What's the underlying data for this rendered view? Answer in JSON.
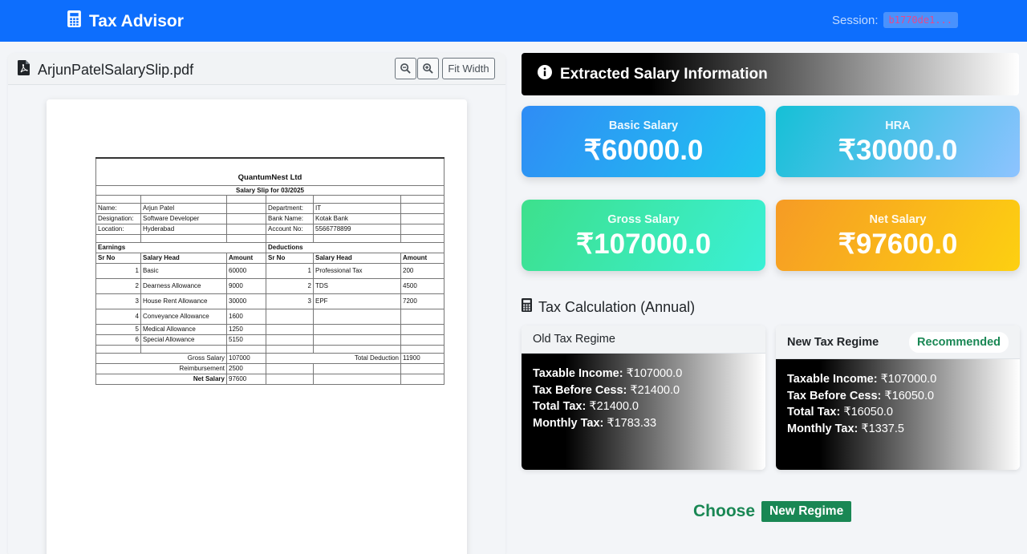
{
  "app": {
    "title": "Tax Advisor",
    "session_label": "Session:",
    "session_id": "b1770de1..."
  },
  "pdf": {
    "filename": "ArjunPatelSalarySlip.pdf",
    "fit_width_label": "Fit Width",
    "slip": {
      "company": "QuantumNest Ltd",
      "subtitle": "Salary Slip for 03/2025",
      "name_label": "Name:",
      "name": "Arjun Patel",
      "department_label": "Department:",
      "department": "IT",
      "designation_label": "Designation:",
      "designation": "Software Developer",
      "bank_label": "Bank Name:",
      "bank": "Kotak Bank",
      "location_label": "Location:",
      "location": "Hyderabad",
      "account_label": "Account No:",
      "account": "5566778899",
      "earnings_label": "Earnings",
      "deductions_label": "Deductions",
      "col_srno": "Sr No",
      "col_head": "Salary Head",
      "col_amount": "Amount",
      "earnings": [
        {
          "sr": "1",
          "head": "Basic",
          "amount": "60000"
        },
        {
          "sr": "2",
          "head": "Dearness Allowance",
          "amount": "9000"
        },
        {
          "sr": "3",
          "head": "House Rent Allowance",
          "amount": "30000"
        },
        {
          "sr": "4",
          "head": "Conveyance Allowance",
          "amount": "1600"
        },
        {
          "sr": "5",
          "head": "Medical Allowance",
          "amount": "1250"
        },
        {
          "sr": "6",
          "head": "Special Allowance",
          "amount": "5150"
        }
      ],
      "deductions": [
        {
          "sr": "1",
          "head": "Professional Tax",
          "amount": "200"
        },
        {
          "sr": "2",
          "head": "TDS",
          "amount": "4500"
        },
        {
          "sr": "3",
          "head": "EPF",
          "amount": "7200"
        }
      ],
      "gross_label": "Gross Salary",
      "gross": "107000",
      "total_deduction_label": "Total Deduction",
      "total_deduction": "11900",
      "reimbursement_label": "Reimbursement",
      "reimbursement": "2500",
      "net_label": "Net Salary",
      "net": "97600"
    }
  },
  "extracted": {
    "title": "Extracted Salary Information",
    "basic_label": "Basic Salary",
    "basic": "₹60000.0",
    "hra_label": "HRA",
    "hra": "₹30000.0",
    "gross_label": "Gross Salary",
    "gross": "₹107000.0",
    "net_label": "Net Salary",
    "net": "₹97600.0"
  },
  "tax": {
    "title": "Tax Calculation (Annual)",
    "old": {
      "title": "Old Tax Regime",
      "taxable_label": "Taxable Income:",
      "taxable": " ₹107000.0",
      "before_cess_label": "Tax Before Cess:",
      "before_cess": " ₹21400.0",
      "total_label": "Total Tax:",
      "total": " ₹21400.0",
      "monthly_label": "Monthly Tax:",
      "monthly": " ₹1783.33"
    },
    "new": {
      "title": "New Tax Regime",
      "badge": "Recommended",
      "taxable_label": "Taxable Income:",
      "taxable": " ₹107000.0",
      "before_cess_label": "Tax Before Cess:",
      "before_cess": " ₹16050.0",
      "total_label": "Total Tax:",
      "total": " ₹16050.0",
      "monthly_label": "Monthly Tax:",
      "monthly": " ₹1337.5"
    }
  },
  "choose": {
    "label": "Choose",
    "button": "New Regime"
  },
  "colors": {
    "navbar": "#0d6efd",
    "success": "#198754"
  }
}
